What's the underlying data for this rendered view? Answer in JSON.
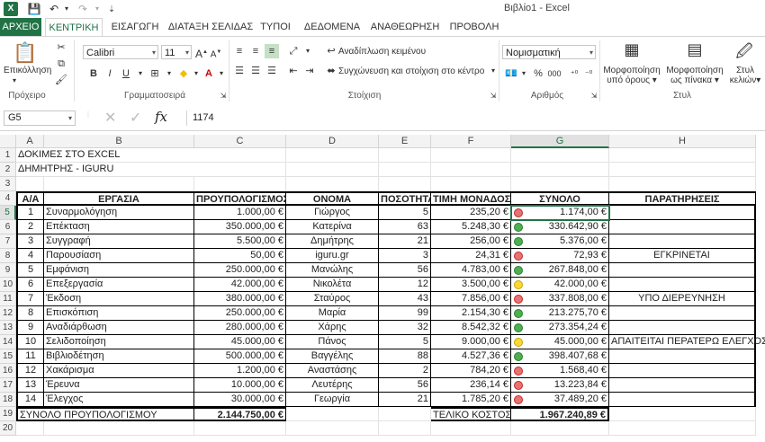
{
  "window": {
    "title": "Βιβλίο1 - Excel"
  },
  "tabs": [
    "ΑΡΧΕΙΟ",
    "ΚΕΝΤΡΙΚΗ",
    "ΕΙΣΑΓΩΓΗ",
    "ΔΙΑΤΑΞΗ ΣΕΛΙΔΑΣ",
    "ΤΥΠΟΙ",
    "ΔΕΔΟΜΕΝΑ",
    "ΑΝΑΘΕΩΡΗΣΗ",
    "ΠΡΟΒΟΛΗ"
  ],
  "ribbon": {
    "paste_label": "Επικόλληση",
    "clipboard_label": "Πρόχειρο",
    "font_name": "Calibri",
    "font_size": "11",
    "font_group_label": "Γραμματοσειρά",
    "wrap_text": "Αναδίπλωση κειμένου",
    "merge_center": "Συγχώνευση και στοίχιση στο κέντρο",
    "alignment_label": "Στοίχιση",
    "number_format": "Νομισματική",
    "number_label": "Αριθμός",
    "cond_format_1": "Μορφοποίηση",
    "cond_format_2": "υπό όρους",
    "format_table_1": "Μορφοποίηση",
    "format_table_2": "ως πίνακα",
    "cell_styles_1": "Στυλ",
    "cell_styles_2": "κελιών",
    "styles_label": "Στυλ",
    "bold": "B",
    "italic": "I",
    "underline": "U",
    "percent": "%",
    "thousands": "000"
  },
  "formula_bar": {
    "name_box": "G5",
    "formula": "1174",
    "fx": "fx"
  },
  "columns": [
    "A",
    "B",
    "C",
    "D",
    "E",
    "F",
    "G",
    "H"
  ],
  "rows": [
    "1",
    "2",
    "3",
    "4",
    "5",
    "6",
    "7",
    "8",
    "9",
    "10",
    "11",
    "12",
    "13",
    "14",
    "15",
    "16",
    "17",
    "18",
    "19",
    "20"
  ],
  "top_lines": [
    "ΔΟΚΙΜΕΣ ΣΤΟ EXCEL",
    "ΔΗΜΗΤΡΗΣ - IGURU"
  ],
  "headers": [
    "Α/Α",
    "ΕΡΓΑΣΙΑ",
    "ΠΡΟΥΠΟΛΟΓΙΣΜΟΣ",
    "ΟΝΟΜΑ",
    "ΠΟΣΟΤΗΤΑ",
    "ΤΙΜΗ ΜΟΝΑΔΟΣ",
    "ΣΥΝΟΛΟ",
    "ΠΑΡΑΤΗΡΗΣΕΙΣ"
  ],
  "table": [
    {
      "n": "1",
      "task": "Συναρμολόγηση",
      "budget": "1.000,00 €",
      "name": "Γιώργος",
      "qty": "5",
      "price": "235,20 €",
      "status": "red",
      "total": "1.174,00 €",
      "note": ""
    },
    {
      "n": "2",
      "task": "Επέκταση",
      "budget": "350.000,00 €",
      "name": "Κατερίνα",
      "qty": "63",
      "price": "5.248,30 €",
      "status": "green",
      "total": "330.642,90 €",
      "note": ""
    },
    {
      "n": "3",
      "task": "Συγγραφή",
      "budget": "5.500,00 €",
      "name": "Δημήτρης",
      "qty": "21",
      "price": "256,00 €",
      "status": "green",
      "total": "5.376,00 €",
      "note": ""
    },
    {
      "n": "4",
      "task": "Παρουσίαση",
      "budget": "50,00 €",
      "name": "iguru.gr",
      "qty": "3",
      "price": "24,31 €",
      "status": "red",
      "total": "72,93 €",
      "note": "ΕΓΚΡΙΝΕΤΑΙ"
    },
    {
      "n": "5",
      "task": "Εμφάνιση",
      "budget": "250.000,00 €",
      "name": "Μανώλης",
      "qty": "56",
      "price": "4.783,00 €",
      "status": "green",
      "total": "267.848,00 €",
      "note": ""
    },
    {
      "n": "6",
      "task": "Επεξεργασία",
      "budget": "42.000,00 €",
      "name": "Νικολέτα",
      "qty": "12",
      "price": "3.500,00 €",
      "status": "yellow",
      "total": "42.000,00 €",
      "note": ""
    },
    {
      "n": "7",
      "task": "Έκδοση",
      "budget": "380.000,00 €",
      "name": "Σταύρος",
      "qty": "43",
      "price": "7.856,00 €",
      "status": "red",
      "total": "337.808,00 €",
      "note": "ΥΠΟ ΔΙΕΡΕΥΝΗΣΗ"
    },
    {
      "n": "8",
      "task": "Επισκόπιση",
      "budget": "250.000,00 €",
      "name": "Μαρία",
      "qty": "99",
      "price": "2.154,30 €",
      "status": "green",
      "total": "213.275,70 €",
      "note": ""
    },
    {
      "n": "9",
      "task": "Αναδιάρθωση",
      "budget": "280.000,00 €",
      "name": "Χάρης",
      "qty": "32",
      "price": "8.542,32 €",
      "status": "green",
      "total": "273.354,24 €",
      "note": ""
    },
    {
      "n": "10",
      "task": "Σελιδοποίηση",
      "budget": "45.000,00 €",
      "name": "Πάνος",
      "qty": "5",
      "price": "9.000,00 €",
      "status": "yellow",
      "total": "45.000,00 €",
      "note": "ΑΠΑΙΤΕΙΤΑΙ ΠΕΡΑΤΕΡΩ ΕΛΕΓΧΟΣ"
    },
    {
      "n": "11",
      "task": "Βιβλιοδέτηση",
      "budget": "500.000,00 €",
      "name": "Βαγγέλης",
      "qty": "88",
      "price": "4.527,36 €",
      "status": "green",
      "total": "398.407,68 €",
      "note": ""
    },
    {
      "n": "12",
      "task": "Χακάρισμα",
      "budget": "1.200,00 €",
      "name": "Αναστάσης",
      "qty": "2",
      "price": "784,20 €",
      "status": "red",
      "total": "1.568,40 €",
      "note": ""
    },
    {
      "n": "13",
      "task": "Έρευνα",
      "budget": "10.000,00 €",
      "name": "Λευτέρης",
      "qty": "56",
      "price": "236,14 €",
      "status": "red",
      "total": "13.223,84 €",
      "note": ""
    },
    {
      "n": "14",
      "task": "Έλεγχος",
      "budget": "30.000,00 €",
      "name": "Γεωργία",
      "qty": "21",
      "price": "1.785,20 €",
      "status": "red",
      "total": "37.489,20 €",
      "note": ""
    }
  ],
  "totals": {
    "budget_label": "ΣΥΝΟΛΟ ΠΡΟΥΠΟΛΟΓΙΣΜΟΥ",
    "budget_value": "2.144.750,00 €",
    "final_label": "ΤΕΛΙΚΟ ΚΟΣΤΟΣ",
    "final_value": "1.967.240,89 €"
  },
  "colors": {
    "accent": "#217346",
    "green": "#4caf50",
    "red": "#e57373",
    "yellow": "#fdd835"
  }
}
